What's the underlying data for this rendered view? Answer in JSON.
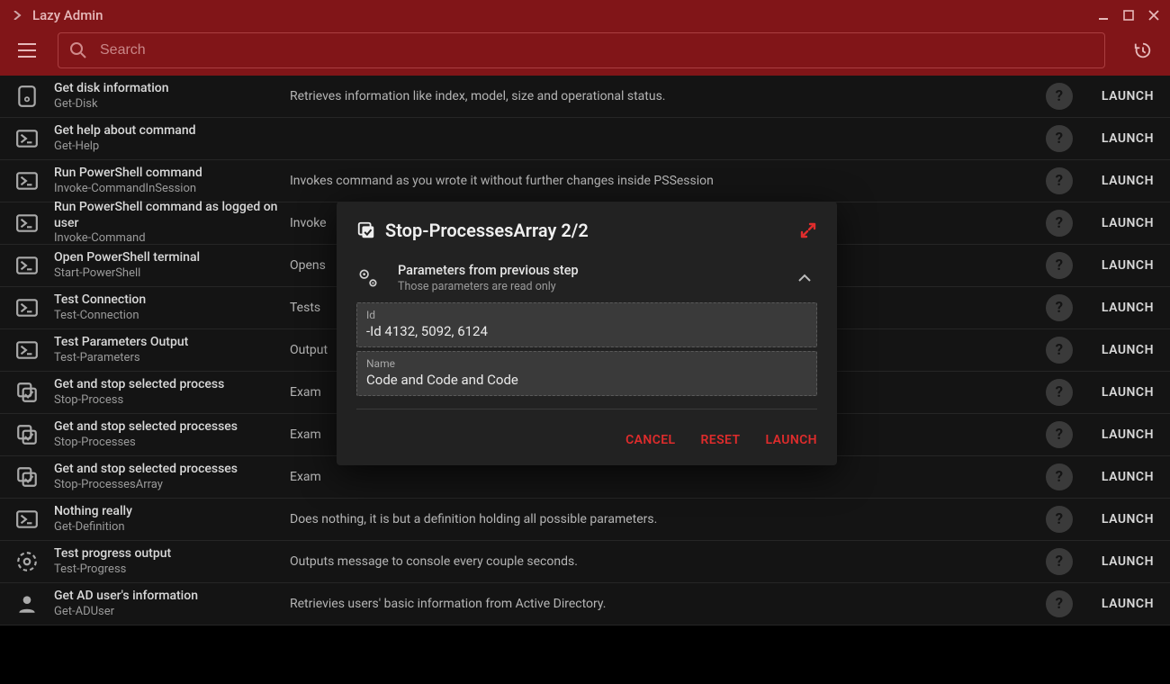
{
  "window": {
    "title": "Lazy Admin"
  },
  "search": {
    "placeholder": "Search",
    "value": ""
  },
  "list": [
    {
      "icon": "disk",
      "title": "Get disk information",
      "sub": "Get-Disk",
      "desc": "Retrieves information like index, model, size and operational status.",
      "launch": "LAUNCH"
    },
    {
      "icon": "ps",
      "title": "Get help about command",
      "sub": "Get-Help",
      "desc": "",
      "launch": "LAUNCH"
    },
    {
      "icon": "ps",
      "title": "Run PowerShell command",
      "sub": "Invoke-CommandInSession",
      "desc": "Invokes command as you wrote it without further changes inside PSSession",
      "launch": "LAUNCH"
    },
    {
      "icon": "ps",
      "title": "Run PowerShell command as logged on user",
      "sub": "Invoke-Command",
      "desc": "Invoke",
      "launch": "LAUNCH"
    },
    {
      "icon": "ps",
      "title": "Open PowerShell terminal",
      "sub": "Start-PowerShell",
      "desc": "Opens",
      "launch": "LAUNCH"
    },
    {
      "icon": "ps",
      "title": "Test Connection",
      "sub": "Test-Connection",
      "desc": "Tests",
      "launch": "LAUNCH"
    },
    {
      "icon": "ps",
      "title": "Test Parameters Output",
      "sub": "Test-Parameters",
      "desc": "Output",
      "launch": "LAUNCH"
    },
    {
      "icon": "check",
      "title": "Get and stop selected process",
      "sub": "Stop-Process",
      "desc": "Exam",
      "launch": "LAUNCH"
    },
    {
      "icon": "check",
      "title": "Get and stop selected processes",
      "sub": "Stop-Processes",
      "desc": "Exam",
      "launch": "LAUNCH"
    },
    {
      "icon": "check",
      "title": "Get and stop selected processes",
      "sub": "Stop-ProcessesArray",
      "desc": "Exam",
      "launch": "LAUNCH"
    },
    {
      "icon": "ps",
      "title": "Nothing really",
      "sub": "Get-Definition",
      "desc": "Does nothing, it is but a definition holding all possible parameters.",
      "launch": "LAUNCH"
    },
    {
      "icon": "prog",
      "title": "Test progress output",
      "sub": "Test-Progress",
      "desc": "Outputs message to console every couple seconds.",
      "launch": "LAUNCH"
    },
    {
      "icon": "user",
      "title": "Get AD user's information",
      "sub": "Get-ADUser",
      "desc": "Retrievies users' basic information from Active Directory.",
      "launch": "LAUNCH"
    }
  ],
  "modal": {
    "title": "Stop-ProcessesArray 2/2",
    "section": {
      "heading": "Parameters from previous step",
      "subheading": "Those parameters are read only"
    },
    "fields": [
      {
        "label": "Id",
        "value": "-Id 4132, 5092, 6124"
      },
      {
        "label": "Name",
        "value": "Code and Code and Code"
      }
    ],
    "actions": {
      "cancel": "CANCEL",
      "reset": "RESET",
      "launch": "LAUNCH"
    }
  }
}
